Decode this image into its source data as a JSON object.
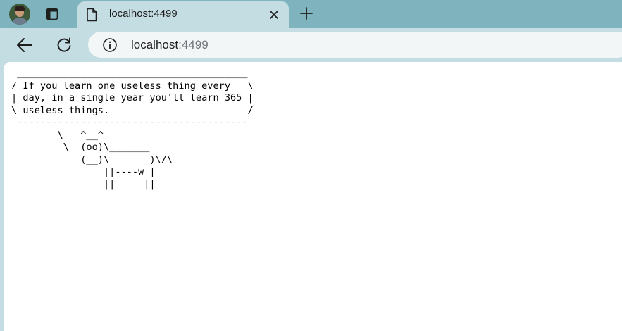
{
  "browser": {
    "tab": {
      "title": "localhost:4499",
      "icon": "page-icon"
    },
    "address_bar": {
      "host": "localhost",
      "port": ":4499",
      "icon": "info-icon"
    },
    "toolbar_icons": [
      "back-arrow-icon",
      "reload-icon"
    ],
    "tabstrip_icons": [
      "profile-avatar",
      "tab-search-icon",
      "close-icon",
      "plus-icon"
    ]
  },
  "page": {
    "cowsay": " ________________________________________\n/ If you learn one useless thing every   \\\n| day, in a single year you'll learn 365 |\n\\ useless things.                        /\n ----------------------------------------\n        \\   ^__^\n         \\  (oo)\\_______\n            (__)\\       )\\/\\\n                ||----w |\n                ||     ||"
  },
  "colors": {
    "tabstrip": "#7fb4be",
    "toolbar": "#c4dde3",
    "omnibox": "#f2f6f7",
    "page_background": "#ffffff"
  }
}
